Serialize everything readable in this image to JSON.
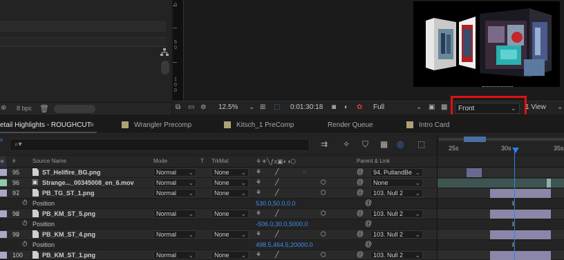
{
  "left_panel": {
    "bpc": "8 bpc"
  },
  "ruler": {
    "ticks": [
      "0",
      "5",
      "0",
      "1",
      "0",
      "0"
    ]
  },
  "viewer_toolbar": {
    "zoom": "12.5%",
    "timecode": "0:01:30:18",
    "resolution": "Full",
    "view": "Front",
    "layout": "1 View"
  },
  "tabs": [
    {
      "label": "etail Highlights - ROUGHCUT",
      "active": true,
      "chip": ""
    },
    {
      "label": "Wrangler Precomp",
      "active": false,
      "chip": "#b0a078"
    },
    {
      "label": "Kitsch_1 PreComp",
      "active": false,
      "chip": "#b0a078"
    },
    {
      "label": "Render Queue",
      "active": false,
      "chip": ""
    },
    {
      "label": "Intro Card",
      "active": false,
      "chip": "#b0a078"
    }
  ],
  "timeline": {
    "labels": [
      "25s",
      "30s",
      "35s"
    ]
  },
  "columns": {
    "num": "#",
    "source": "Source Name",
    "mode": "Mode",
    "t": "T",
    "trkmat": "TrkMat",
    "parent": "Parent & Link"
  },
  "layers": [
    {
      "num": "95",
      "name": "ST_Hellfire_BG.png",
      "mode": "Normal",
      "trkmat": "None",
      "parent": "94. PullandBe",
      "label_color": "#a8a8c8"
    },
    {
      "num": "96",
      "name": "Strange..._00345008_en_6.mov",
      "mode": "Normal",
      "trkmat": "None",
      "parent": "None",
      "label_color": "#8fc8b0"
    },
    {
      "num": "97",
      "name": "PB_TG_ST_1.png",
      "mode": "Normal",
      "trkmat": "None",
      "parent": "103. Null 2",
      "label_color": "#a8a8c8",
      "prop": {
        "name": "Position",
        "value": "530.0,50.0,0.0"
      }
    },
    {
      "num": "98",
      "name": "PB_KM_ST_5.png",
      "mode": "Normal",
      "trkmat": "None",
      "parent": "103. Null 2",
      "label_color": "#a8a8c8",
      "prop": {
        "name": "Position",
        "value": "-506.0,30.0,5000.0"
      }
    },
    {
      "num": "99",
      "name": "PB_KM_ST_4.png",
      "mode": "Normal",
      "trkmat": "None",
      "parent": "103. Null 2",
      "label_color": "#a8a8c8",
      "prop": {
        "name": "Position",
        "value": "498.5,464.5,20000.0"
      }
    },
    {
      "num": "100",
      "name": "PB_KM_ST_1.png",
      "mode": "Normal",
      "trkmat": "None",
      "parent": "103. Null 2",
      "label_color": "#a8a8c8"
    }
  ],
  "icons": {
    "search": "search-icon",
    "keyframe": "keyframe-icon",
    "stopwatch": "stopwatch-icon",
    "pickwhip": "pickwhip-icon"
  },
  "colors": {
    "accent_blue": "#2f80ed",
    "highlight_red": "#e01010",
    "layer_bar": "#8a87a8"
  }
}
